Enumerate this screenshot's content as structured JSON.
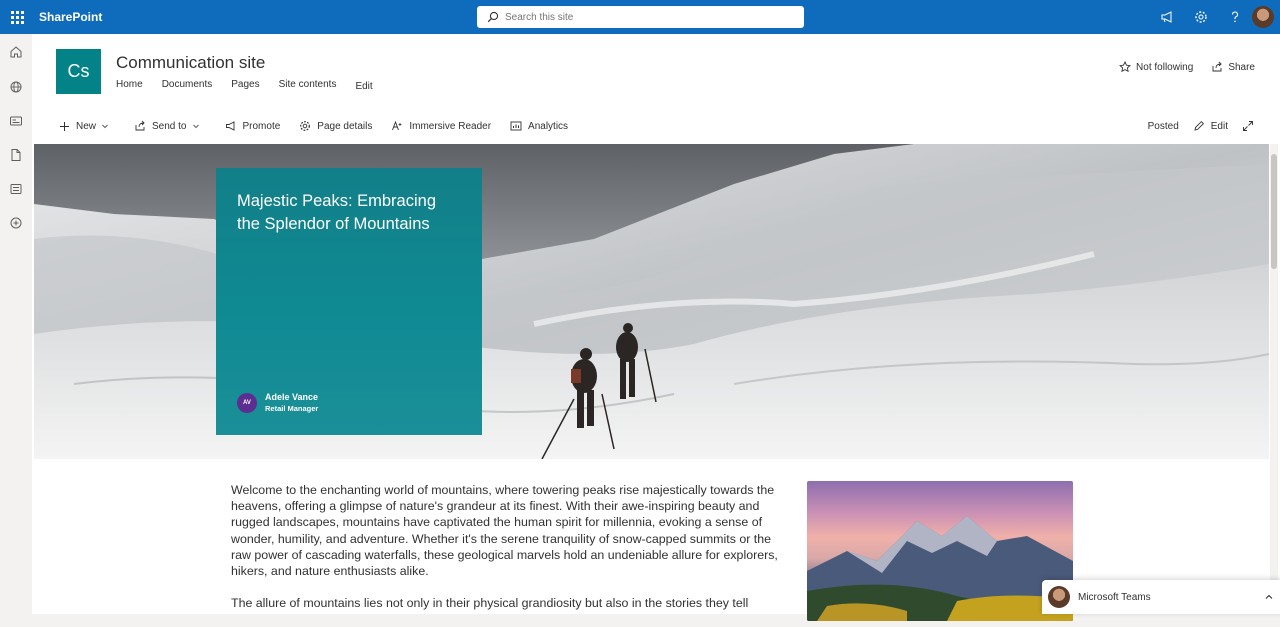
{
  "suitebar": {
    "app_name": "SharePoint",
    "search_placeholder": "Search this site"
  },
  "site": {
    "logo_initials": "Cs",
    "title": "Communication site",
    "nav": [
      "Home",
      "Documents",
      "Pages",
      "Site contents",
      "Edit"
    ],
    "not_following_label": "Not following",
    "share_label": "Share"
  },
  "commandbar": {
    "new_label": "New",
    "send_to_label": "Send to",
    "promote_label": "Promote",
    "page_details_label": "Page details",
    "immersive_reader_label": "Immersive Reader",
    "analytics_label": "Analytics",
    "status_label": "Posted",
    "edit_label": "Edit"
  },
  "hero": {
    "title": "Majestic Peaks: Embracing the Splendor of Mountains",
    "author_initials": "AV",
    "author_name": "Adele Vance",
    "author_role": "Retail Manager"
  },
  "article": {
    "paragraph1": "Welcome to the enchanting world of mountains, where towering peaks rise majestically towards the heavens, offering a glimpse of nature's grandeur at its finest. With their awe-inspiring beauty and rugged landscapes, mountains have captivated the human spirit for millennia, evoking a sense of wonder, humility, and adventure. Whether it's the serene tranquility of snow-capped summits or the raw power of cascading waterfalls, these geological marvels hold an undeniable allure for explorers, hikers, and nature enthusiasts alike.",
    "paragraph2": "The allure of mountains lies not only in their physical grandiosity but also in the stories they tell"
  },
  "teams": {
    "label": "Microsoft Teams"
  }
}
